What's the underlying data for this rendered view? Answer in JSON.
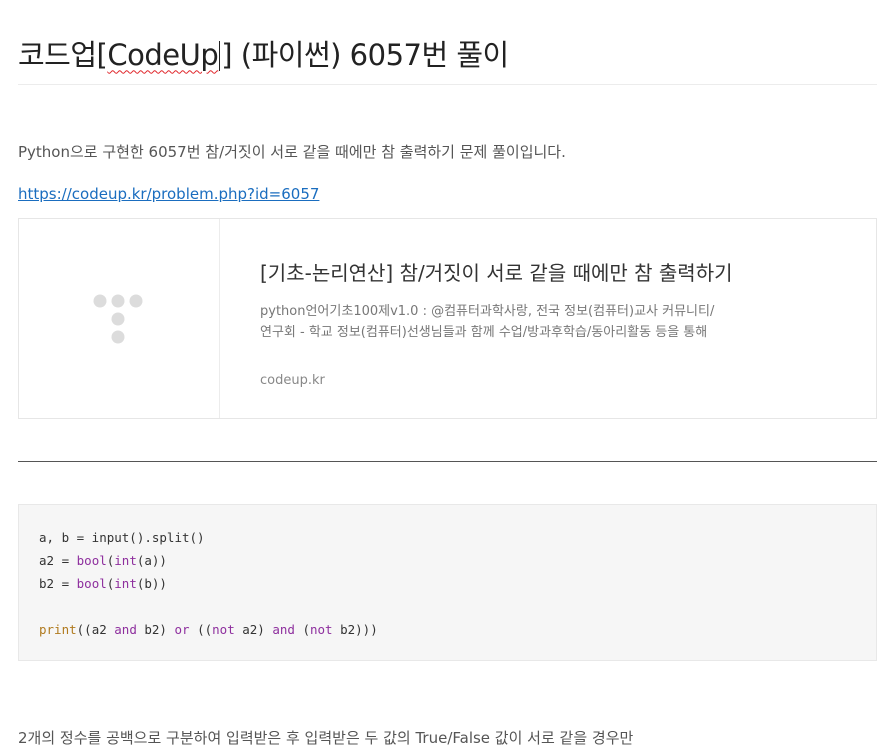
{
  "post": {
    "title_prefix": "코드업[",
    "title_brand": "CodeUp",
    "title_suffix": "] (파이썬) 6057번 풀이",
    "intro": "Python으로 구현한 6057번 참/거짓이 서로 같을 때에만 참 출력하기 문제 풀이입니다.",
    "link": "https://codeup.kr/problem.php?id=6057",
    "outro": "2개의 정수를 공백으로 구분하여 입력받은 후 입력받은 두 값의 True/False 값이 서로 같을 경우만"
  },
  "og_card": {
    "title": "[기초-논리연산] 참/거짓이 서로 같을 때에만 참 출력하기",
    "description": "python언어기초100제v1.0 : @컴퓨터과학사랑, 전국 정보(컴퓨터)교사 커뮤니티/연구회 - 학교 정보(컴퓨터)선생님들과 함께 수업/방과후학습/동아리활동 등을 통해 다양한 컴퓨터 과학 교육을 합니다.",
    "host": "codeup.kr",
    "thumbnail_icon": "placeholder-logo-icon"
  },
  "code": {
    "line1_a": "a, b = input().split()",
    "line2_a": "a2 = ",
    "line2_bool": "bool",
    "line2_b": "(",
    "line2_int": "int",
    "line2_c": "(a))",
    "line3_a": "b2 = ",
    "line3_bool": "bool",
    "line3_b": "(",
    "line3_int": "int",
    "line3_c": "(b))",
    "line5_print": "print",
    "line5_a": "((a2 ",
    "line5_and1": "and",
    "line5_b": " b2) ",
    "line5_or": "or",
    "line5_c": " ((",
    "line5_not1": "not",
    "line5_d": " a2) ",
    "line5_and2": "and",
    "line5_e": " (",
    "line5_not2": "not",
    "line5_f": " b2)))"
  },
  "colors": {
    "link": "#1a6dbf",
    "code_keyword": "#8e2f9e",
    "code_print": "#b07a1e",
    "spellcheck_underline": "#e0262b"
  }
}
